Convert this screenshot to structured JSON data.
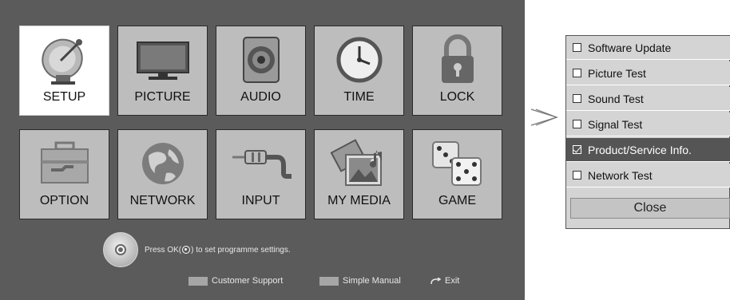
{
  "main_menu": {
    "tiles": [
      {
        "label": "SETUP",
        "icon": "satellite-dish-icon",
        "selected": true
      },
      {
        "label": "PICTURE",
        "icon": "tv-monitor-icon"
      },
      {
        "label": "AUDIO",
        "icon": "speaker-icon"
      },
      {
        "label": "TIME",
        "icon": "clock-icon"
      },
      {
        "label": "LOCK",
        "icon": "padlock-icon"
      },
      {
        "label": "OPTION",
        "icon": "toolbox-icon"
      },
      {
        "label": "NETWORK",
        "icon": "globe-icon"
      },
      {
        "label": "INPUT",
        "icon": "av-plug-icon"
      },
      {
        "label": "MY MEDIA",
        "icon": "media-icon"
      },
      {
        "label": "GAME",
        "icon": "dice-icon"
      }
    ],
    "hint": {
      "prefix": "Press OK(",
      "suffix": ") to set programme settings."
    },
    "footer": {
      "customer_support": "Customer Support",
      "simple_manual": "Simple Manual",
      "exit": "Exit"
    }
  },
  "arrow": {
    "glyph": ">"
  },
  "test_menu": {
    "options": [
      {
        "label": "Software Update",
        "checked": false
      },
      {
        "label": "Picture Test",
        "checked": false
      },
      {
        "label": "Sound Test",
        "checked": false
      },
      {
        "label": "Signal Test",
        "checked": false
      },
      {
        "label": "Product/Service Info.",
        "checked": true,
        "active": true
      },
      {
        "label": "Network Test",
        "checked": false
      }
    ],
    "close_label": "Close"
  },
  "colors": {
    "menu_bg": "#5b5b5b",
    "tile_bg": "#bdbdbd",
    "selected_tile_bg": "#ffffff",
    "active_option_bg": "#555555"
  }
}
